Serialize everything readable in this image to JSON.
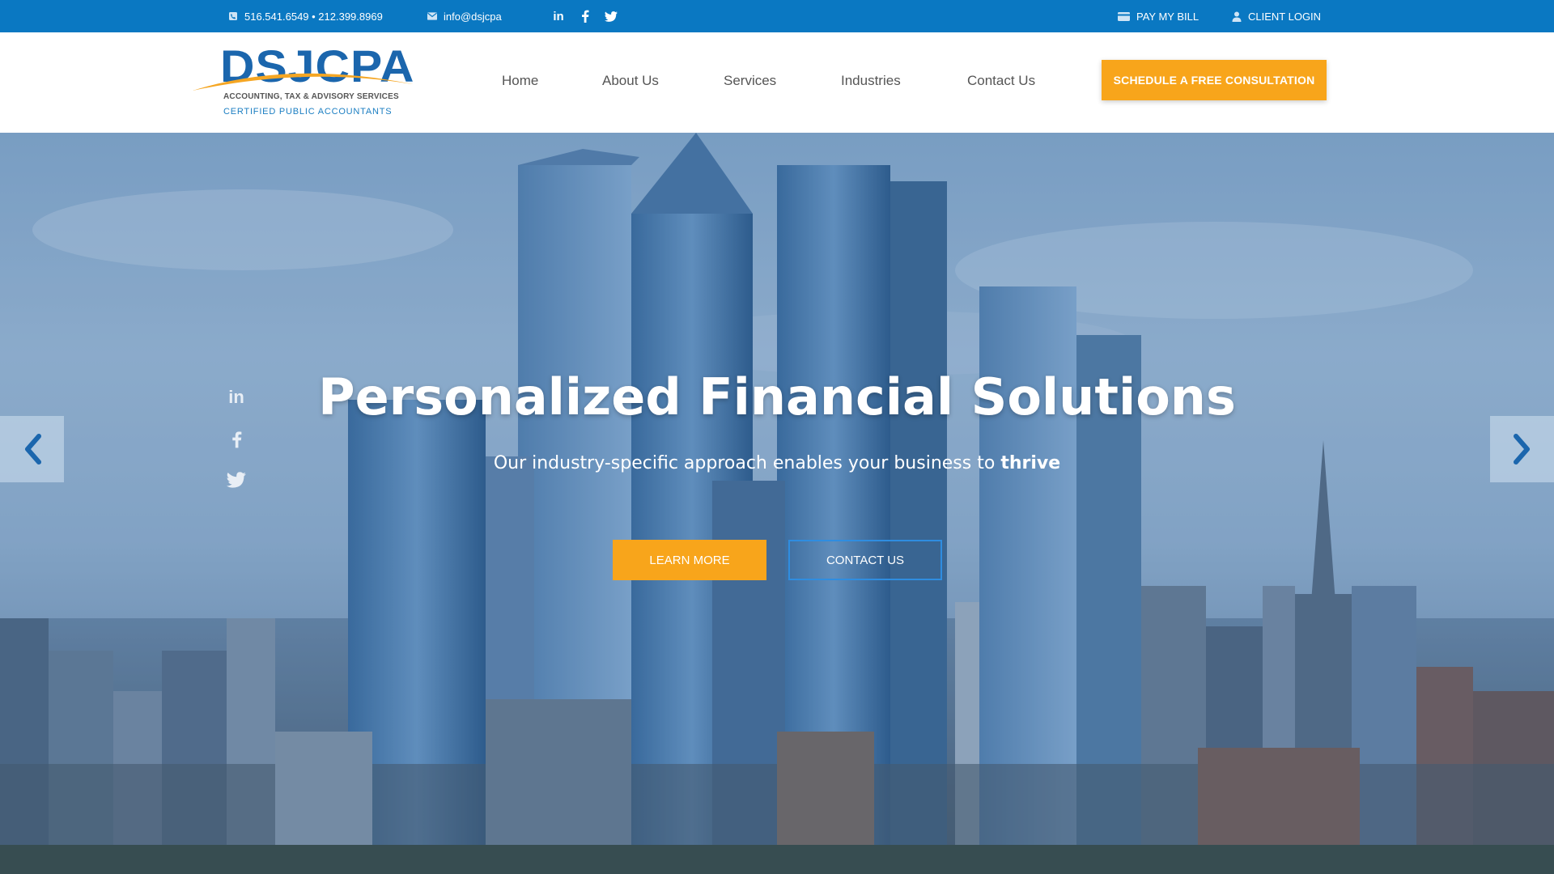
{
  "topbar": {
    "phone": "516.541.6549 • 212.399.8969",
    "email": "info@dsjcpa",
    "social": {
      "linkedin": "in",
      "facebook": "f",
      "twitter": "twitter"
    },
    "pay_bill": "PAY MY BILL",
    "client_login": "CLIENT LOGIN"
  },
  "logo": {
    "mark": "DSJCPA",
    "tagline": "ACCOUNTING, TAX & ADVISORY SERVICES",
    "subtitle": "CERTIFIED PUBLIC ACCOUNTANTS"
  },
  "nav": {
    "items": [
      {
        "label": "Home"
      },
      {
        "label": "About Us"
      },
      {
        "label": "Services"
      },
      {
        "label": "Industries"
      },
      {
        "label": "Contact Us"
      }
    ],
    "cta": "SCHEDULE A FREE CONSULTATION"
  },
  "hero": {
    "title": "Personalized Financial Solutions",
    "subtitle_prefix": "Our industry-specific approach enables your business to ",
    "subtitle_emphasis": "thrive",
    "learn_more": "LEARN MORE",
    "contact_us": "CONTACT US"
  },
  "colors": {
    "topbar": "#0a78c2",
    "accent": "#f8a51b",
    "brand_blue": "#1b66ad"
  }
}
